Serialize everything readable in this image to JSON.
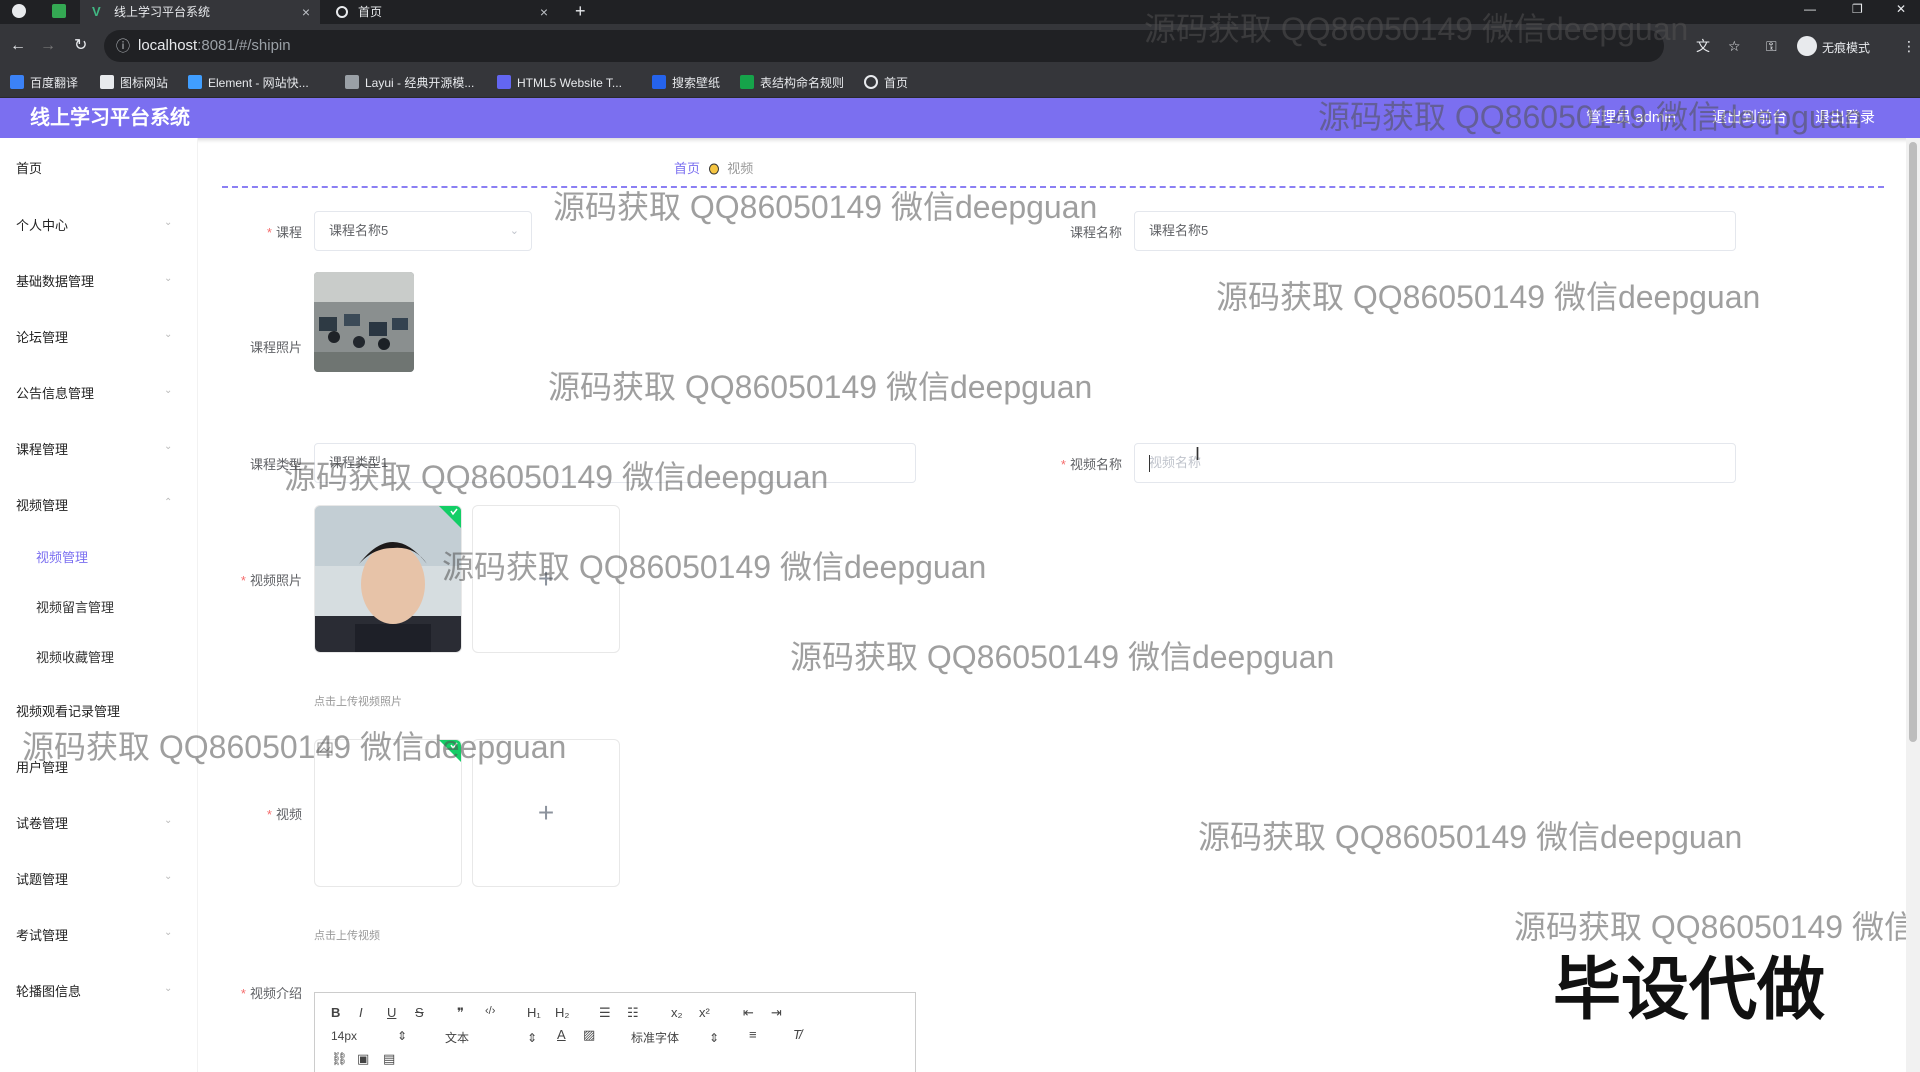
{
  "browser": {
    "tabs": [
      {
        "title": "线上学习平台系统",
        "close": "×"
      },
      {
        "title": "首页",
        "close": "×"
      }
    ],
    "new_tab": "+",
    "url_host": "localhost",
    "url_path": ":8081/#/shipin",
    "incognito_label": "无痕模式",
    "bookmarks": [
      "百度翻译",
      "图标网站",
      "Element - 网站快...",
      "Layui - 经典开源模...",
      "HTML5 Website T...",
      "搜索壁纸",
      "表结构命名规则",
      "首页"
    ]
  },
  "app": {
    "title": "线上学习平台系统",
    "header_links": [
      "管理员 admin",
      "退出到前台",
      "退出登录"
    ]
  },
  "sidebar": {
    "items": [
      {
        "label": "首页"
      },
      {
        "label": "个人中心"
      },
      {
        "label": "基础数据管理"
      },
      {
        "label": "论坛管理"
      },
      {
        "label": "公告信息管理"
      },
      {
        "label": "课程管理"
      },
      {
        "label": "视频管理"
      }
    ],
    "sub_items": [
      {
        "label": "视频管理"
      },
      {
        "label": "视频留言管理"
      },
      {
        "label": "视频收藏管理"
      }
    ],
    "items_after": [
      {
        "label": "视频观看记录管理"
      },
      {
        "label": "用户管理"
      },
      {
        "label": "试卷管理"
      },
      {
        "label": "试题管理"
      },
      {
        "label": "考试管理"
      },
      {
        "label": "轮播图信息"
      }
    ]
  },
  "breadcrumb": {
    "home": "首页",
    "current": "视频"
  },
  "form": {
    "course_label": "课程",
    "course_value": "课程名称5",
    "course_name_label": "课程名称",
    "course_name_value": "课程名称5",
    "course_photo_label": "课程照片",
    "course_type_label": "课程类型",
    "course_type_value": "课程类型1",
    "video_name_label": "视频名称",
    "video_name_placeholder": "视频名称",
    "video_photo_label": "视频照片",
    "video_photo_tip": "点击上传视频照片",
    "video_label": "视频",
    "video_tip": "点击上传视频",
    "video_intro_label": "视频介绍",
    "required_mark": "*",
    "upload_plus": "+"
  },
  "editor": {
    "font_size": "14px",
    "paragraph": "文本",
    "font_family": "标准字体"
  },
  "watermark_text": "源码获取 QQ86050149 微信deepguan",
  "corner_mark": "毕设代做",
  "colors": {
    "accent": "#7b6ff0",
    "required": "#f56c6c"
  }
}
